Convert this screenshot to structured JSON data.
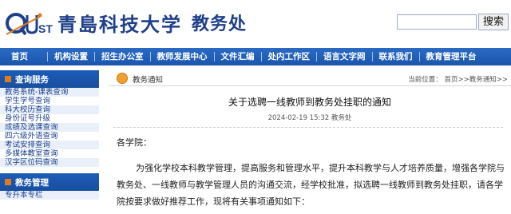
{
  "header": {
    "logo_mark": "QUST",
    "school_name": "青島科技大学",
    "dept_name": "教务处",
    "search_placeholder": "",
    "search_button": "搜索"
  },
  "nav": {
    "items": [
      "首页",
      "机构设置",
      "招生办公室",
      "教师发展中心",
      "文件汇编",
      "处内工作区",
      "语言文字网",
      "联系我们",
      "教育管理平台"
    ]
  },
  "sidebar": {
    "section1_title": "查询服务",
    "section1_items": [
      "教务系统-课表查询",
      "学生学号查询",
      "科大校历查询",
      "身份证号升级",
      "成绩及选课查询",
      "四六级外语查询",
      "考试安排查询",
      "多媒体教室查询",
      "汉字区位码查询"
    ],
    "section2_title": "教务管理",
    "section2_items": [
      "专升本专栏"
    ]
  },
  "breadcrumb": {
    "section": "教务通知",
    "path": "当前位置： 首页>>教务通知>>"
  },
  "article": {
    "title": "关于选聘一线教师到教务处挂职的通知",
    "meta": "2024-02-19 15:32 教务处",
    "salutation": "各学院：",
    "paragraph": "为强化学校本科教学管理，提高服务和管理水平，提升本科教学与人才培养质量，增强各学院与教务处、一线教师与教学管理人员的沟通交流，经学校批准，拟选聘一线教师到教务处挂职，请各学院按要求做好推荐工作，现将有关事项通知如下："
  },
  "colors": {
    "brand_blue": "#1f3f8a",
    "nav_blue": "#1b55ad",
    "accent_orange": "#e07b1c"
  }
}
